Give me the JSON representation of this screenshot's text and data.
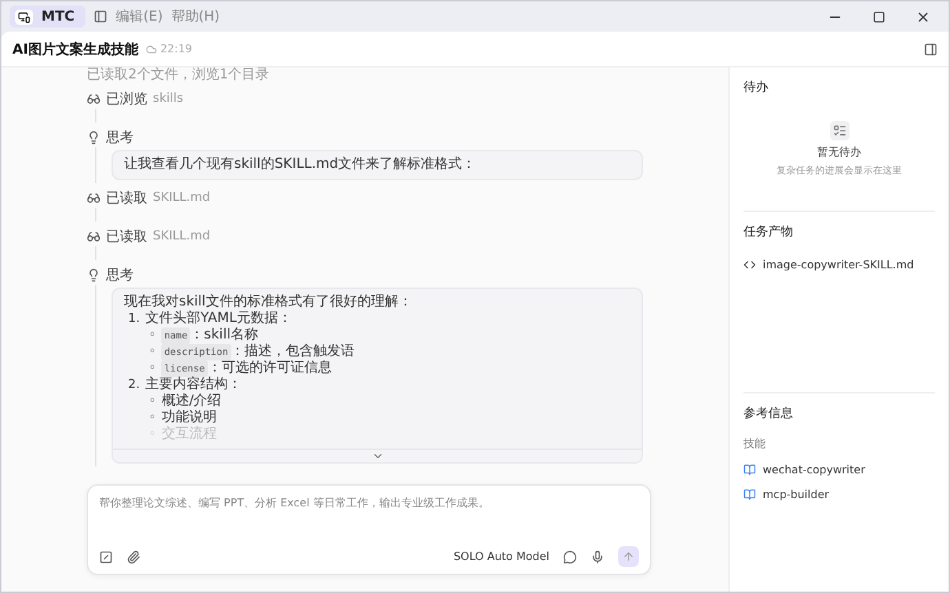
{
  "titlebar": {
    "app": "MTC",
    "menus": [
      "编辑(E)",
      "帮助(H)"
    ]
  },
  "header": {
    "title": "AI图片文案生成技能",
    "time": "22:19"
  },
  "steps": [
    {
      "kind": "summary",
      "text": "已读取2个文件，浏览1个目录"
    },
    {
      "kind": "action",
      "label": "已浏览",
      "target": "skills"
    },
    {
      "kind": "thought",
      "label": "思考",
      "intro": "让我查看几个现有skill的SKILL.md文件来了解标准格式："
    },
    {
      "kind": "action",
      "label": "已读取",
      "target": "SKILL.md"
    },
    {
      "kind": "action",
      "label": "已读取",
      "target": "SKILL.md"
    },
    {
      "kind": "thought",
      "label": "思考",
      "expanded": false,
      "intro": "现在我对skill文件的标准格式有了很好的理解：",
      "list": [
        {
          "marker": "1.",
          "text": "文件头部YAML元数据：",
          "children": [
            {
              "marker": "◦",
              "code": "name",
              "text": "：skill名称"
            },
            {
              "marker": "◦",
              "code": "description",
              "text": "：描述，包含触发语"
            },
            {
              "marker": "◦",
              "code": "license",
              "text": "：可选的许可证信息"
            }
          ]
        },
        {
          "marker": "2.",
          "text": "主要内容结构：",
          "children": [
            {
              "marker": "◦",
              "text": "概述/介绍"
            },
            {
              "marker": "◦",
              "text": "功能说明"
            },
            {
              "marker": "◦",
              "text": "交互流程"
            }
          ]
        }
      ]
    }
  ],
  "composer": {
    "placeholder": "帮你整理论文综述、编写 PPT、分析 Excel 等日常工作，输出专业级工作成果。",
    "model": "SOLO Auto Model"
  },
  "todo": {
    "title": "待办",
    "empty_title": "暂无待办",
    "empty_hint": "复杂任务的进展会显示在这里"
  },
  "outputs": {
    "title": "任务产物",
    "files": [
      "image-copywriter-SKILL.md"
    ]
  },
  "references": {
    "title": "参考信息",
    "group": "技能",
    "skills": [
      "wechat-copywriter",
      "mcp-builder"
    ]
  }
}
